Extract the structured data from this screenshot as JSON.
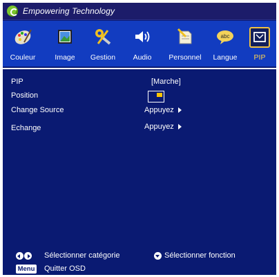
{
  "header": {
    "title": "Empowering Technology",
    "logo_icon": "e-logo-icon"
  },
  "tabs": [
    {
      "label": "Couleur",
      "icon": "palette-icon",
      "active": false
    },
    {
      "label": "Image",
      "icon": "picture-icon",
      "active": false
    },
    {
      "label": "Gestion",
      "icon": "tools-icon",
      "active": false
    },
    {
      "label": "Audio",
      "icon": "speaker-icon",
      "active": false
    },
    {
      "label": "Personnel",
      "icon": "document-pen-icon",
      "active": false
    },
    {
      "label": "Langue",
      "icon": "speech-bubble-abc-icon",
      "active": false
    },
    {
      "label": "PIP",
      "icon": "pip-window-icon",
      "active": true
    }
  ],
  "settings": {
    "pip": {
      "label": "PIP",
      "value": "[Marche]"
    },
    "position": {
      "label": "Position"
    },
    "change_source": {
      "label": "Change Source",
      "value": "Appuyez"
    },
    "echange": {
      "label": "Echange",
      "value": "Appuyez"
    }
  },
  "footer": {
    "select_category": "Sélectionner catégorie",
    "select_function": "Sélectionner fonction",
    "menu_key": "Menu",
    "quit": "Quitter OSD"
  },
  "colors": {
    "background": "#0a1a72",
    "iconbar": "#123cc0",
    "active": "#ffd34d"
  }
}
